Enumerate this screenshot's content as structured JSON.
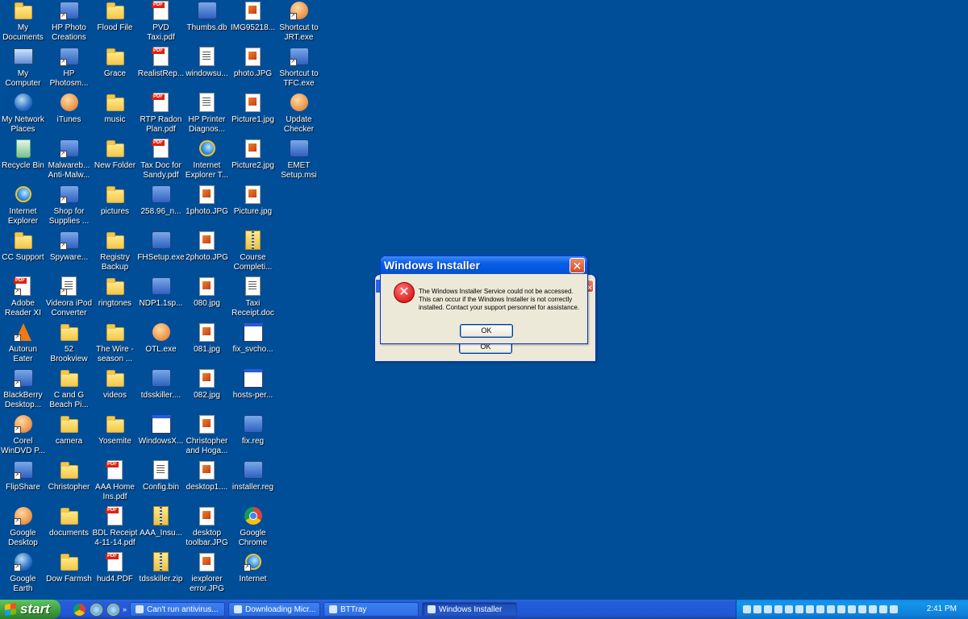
{
  "desktop": {
    "icons": [
      {
        "label": "My\nDocuments",
        "icon": "my-documents-icon",
        "type": "folder",
        "shortcut": false
      },
      {
        "label": "My\nComputer",
        "icon": "my-computer-icon",
        "type": "pc",
        "shortcut": false
      },
      {
        "label": "My Network\nPlaces",
        "icon": "network-places-icon",
        "type": "globe",
        "shortcut": false
      },
      {
        "label": "Recycle Bin",
        "icon": "recycle-bin-icon",
        "type": "bin",
        "shortcut": false
      },
      {
        "label": "Internet\nExplorer",
        "icon": "internet-explorer-icon",
        "type": "ie",
        "shortcut": false
      },
      {
        "label": "CC Support",
        "icon": "folder-icon",
        "type": "folder",
        "shortcut": false
      },
      {
        "label": "Adobe\nReader XI",
        "icon": "adobe-reader-icon",
        "type": "pdf",
        "shortcut": true
      },
      {
        "label": "Autorun\nEater",
        "icon": "autorun-eater-icon",
        "type": "cone",
        "shortcut": true
      },
      {
        "label": "BlackBerry\nDesktop...",
        "icon": "blackberry-icon",
        "type": "app",
        "shortcut": true
      },
      {
        "label": "Corel\nWinDVD P...",
        "icon": "corel-windvd-icon",
        "type": "round",
        "shortcut": true
      },
      {
        "label": "FlipShare",
        "icon": "flipshare-icon",
        "type": "app",
        "shortcut": true
      },
      {
        "label": "Google\nDesktop",
        "icon": "google-desktop-icon",
        "type": "round",
        "shortcut": true
      },
      {
        "label": "Google\nEarth",
        "icon": "google-earth-icon",
        "type": "globe",
        "shortcut": true
      },
      {
        "label": "HP Photo\nCreations",
        "icon": "hp-photo-icon",
        "type": "app",
        "shortcut": true
      },
      {
        "label": "HP\nPhotosm...",
        "icon": "hp-photosmart-icon",
        "type": "app",
        "shortcut": true
      },
      {
        "label": "iTunes",
        "icon": "itunes-icon",
        "type": "round",
        "shortcut": false
      },
      {
        "label": "Malwareb...\nAnti-Malw...",
        "icon": "malwarebytes-icon",
        "type": "app",
        "shortcut": true
      },
      {
        "label": "Shop for\nSupplies ...",
        "icon": "shop-supplies-icon",
        "type": "app",
        "shortcut": true
      },
      {
        "label": "Spyware...",
        "icon": "spyware-icon",
        "type": "app",
        "shortcut": true
      },
      {
        "label": "Videora iPod\nConverter",
        "icon": "videora-icon",
        "type": "doc",
        "shortcut": true
      },
      {
        "label": "52\nBrookview",
        "icon": "folder-icon",
        "type": "folder",
        "shortcut": false
      },
      {
        "label": "C and G\nBeach Pi...",
        "icon": "folder-icon",
        "type": "folder",
        "shortcut": false
      },
      {
        "label": "camera",
        "icon": "folder-icon",
        "type": "folder",
        "shortcut": false
      },
      {
        "label": "Christopher",
        "icon": "folder-icon",
        "type": "folder",
        "shortcut": false
      },
      {
        "label": "documents",
        "icon": "folder-icon",
        "type": "folder",
        "shortcut": false
      },
      {
        "label": "Dow Farmsh",
        "icon": "folder-icon",
        "type": "folder",
        "shortcut": false
      },
      {
        "label": "Flood File",
        "icon": "folder-icon",
        "type": "folder",
        "shortcut": false
      },
      {
        "label": "Grace",
        "icon": "folder-icon",
        "type": "folder",
        "shortcut": false
      },
      {
        "label": "music",
        "icon": "folder-icon",
        "type": "folder",
        "shortcut": false
      },
      {
        "label": "New Folder",
        "icon": "folder-icon",
        "type": "folder",
        "shortcut": false
      },
      {
        "label": "pictures",
        "icon": "folder-icon",
        "type": "folder",
        "shortcut": false
      },
      {
        "label": "Registry\nBackup",
        "icon": "folder-icon",
        "type": "folder",
        "shortcut": false
      },
      {
        "label": "ringtones",
        "icon": "folder-icon",
        "type": "folder",
        "shortcut": false
      },
      {
        "label": "The Wire -\nseason ...",
        "icon": "folder-icon",
        "type": "folder",
        "shortcut": false
      },
      {
        "label": "videos",
        "icon": "folder-icon",
        "type": "folder",
        "shortcut": false
      },
      {
        "label": "Yosemite",
        "icon": "folder-icon",
        "type": "folder",
        "shortcut": false
      },
      {
        "label": "AAA Home\nIns.pdf",
        "icon": "pdf-icon",
        "type": "pdf",
        "shortcut": false
      },
      {
        "label": "BDL Receipt\n4-11-14.pdf",
        "icon": "pdf-icon",
        "type": "pdf",
        "shortcut": false
      },
      {
        "label": "hud4.PDF",
        "icon": "pdf-icon",
        "type": "pdf",
        "shortcut": false
      },
      {
        "label": "PVD\nTaxi.pdf",
        "icon": "pdf-icon",
        "type": "pdf",
        "shortcut": false
      },
      {
        "label": "RealistRep...",
        "icon": "pdf-icon",
        "type": "pdf",
        "shortcut": false
      },
      {
        "label": "RTP Radon\nPlan.pdf",
        "icon": "pdf-icon",
        "type": "pdf",
        "shortcut": false
      },
      {
        "label": "Tax Doc for\nSandy.pdf",
        "icon": "pdf-icon",
        "type": "pdf",
        "shortcut": false
      },
      {
        "label": "258.96_n...",
        "icon": "nvidia-icon",
        "type": "app",
        "shortcut": false
      },
      {
        "label": "FHSetup.exe",
        "icon": "setup-icon",
        "type": "app",
        "shortcut": false
      },
      {
        "label": "NDP1.1sp...",
        "icon": "setup-icon",
        "type": "app",
        "shortcut": false
      },
      {
        "label": "OTL.exe",
        "icon": "otl-icon",
        "type": "round",
        "shortcut": false
      },
      {
        "label": "tdsskiller....",
        "icon": "tdsskiller-icon",
        "type": "app",
        "shortcut": false
      },
      {
        "label": "WindowsX...",
        "icon": "window-icon",
        "type": "win",
        "shortcut": false
      },
      {
        "label": "Config.bin",
        "icon": "file-icon",
        "type": "doc",
        "shortcut": false
      },
      {
        "label": "AAA_Insu...",
        "icon": "zip-icon",
        "type": "zip",
        "shortcut": false
      },
      {
        "label": "tdsskiller.zip",
        "icon": "zip-icon",
        "type": "zip",
        "shortcut": false
      },
      {
        "label": "Thumbs.db",
        "icon": "thumbs-db-icon",
        "type": "app",
        "shortcut": false
      },
      {
        "label": "windowsu...",
        "icon": "file-icon",
        "type": "doc",
        "shortcut": false
      },
      {
        "label": "HP Printer\nDiagnos...",
        "icon": "file-icon",
        "type": "doc",
        "shortcut": false
      },
      {
        "label": "Internet\nExplorer T...",
        "icon": "internet-explorer-icon",
        "type": "ie",
        "shortcut": false
      },
      {
        "label": "1photo.JPG",
        "icon": "image-icon",
        "type": "img",
        "shortcut": false
      },
      {
        "label": "2photo.JPG",
        "icon": "image-icon",
        "type": "img",
        "shortcut": false
      },
      {
        "label": "080.jpg",
        "icon": "image-icon",
        "type": "img",
        "shortcut": false
      },
      {
        "label": "081.jpg",
        "icon": "image-icon",
        "type": "img",
        "shortcut": false
      },
      {
        "label": "082.jpg",
        "icon": "image-icon",
        "type": "img",
        "shortcut": false
      },
      {
        "label": "Christopher\nand Hoga...",
        "icon": "image-icon",
        "type": "img",
        "shortcut": false
      },
      {
        "label": "desktop1....",
        "icon": "image-icon",
        "type": "img",
        "shortcut": false
      },
      {
        "label": "desktop\ntoolbar.JPG",
        "icon": "image-icon",
        "type": "img",
        "shortcut": false
      },
      {
        "label": "iexplorer\nerror.JPG",
        "icon": "image-icon",
        "type": "img",
        "shortcut": false
      },
      {
        "label": "IMG95218...",
        "icon": "image-icon",
        "type": "img",
        "shortcut": false
      },
      {
        "label": "photo.JPG",
        "icon": "image-icon",
        "type": "img",
        "shortcut": false
      },
      {
        "label": "Picture1.jpg",
        "icon": "image-icon",
        "type": "img",
        "shortcut": false
      },
      {
        "label": "Picture2.jpg",
        "icon": "image-icon",
        "type": "img",
        "shortcut": false
      },
      {
        "label": "Picture.jpg",
        "icon": "image-icon",
        "type": "img",
        "shortcut": false
      },
      {
        "label": "Course\nCompleti...",
        "icon": "file-icon",
        "type": "zip",
        "shortcut": false
      },
      {
        "label": "Taxi\nReceipt.doc",
        "icon": "word-doc-icon",
        "type": "doc",
        "shortcut": false
      },
      {
        "label": "fix_svcho...",
        "icon": "script-icon",
        "type": "win",
        "shortcut": false
      },
      {
        "label": "hosts-per...",
        "icon": "script-icon",
        "type": "win",
        "shortcut": false
      },
      {
        "label": "fix.reg",
        "icon": "reg-icon",
        "type": "app",
        "shortcut": false
      },
      {
        "label": "installer.reg",
        "icon": "reg-icon",
        "type": "app",
        "shortcut": false
      },
      {
        "label": "Google\nChrome",
        "icon": "chrome-icon",
        "type": "chrome",
        "shortcut": false
      },
      {
        "label": "Internet",
        "icon": "internet-explorer-icon",
        "type": "ie",
        "shortcut": true
      },
      {
        "label": "Shortcut to\nJRT.exe",
        "icon": "jrt-icon",
        "type": "round",
        "shortcut": true
      },
      {
        "label": "Shortcut to\nTFC.exe",
        "icon": "tfc-icon",
        "type": "app",
        "shortcut": true
      },
      {
        "label": "Update\nChecker",
        "icon": "update-checker-icon",
        "type": "round",
        "shortcut": false
      },
      {
        "label": "EMET\nSetup.msi",
        "icon": "installer-icon",
        "type": "app",
        "shortcut": false
      }
    ]
  },
  "dialog": {
    "title": "Windows Installer",
    "message": "The Windows Installer Service could not be accessed. This can occur if the Windows Installer is not correctly installed. Contact your support personnel for assistance.",
    "ok_label": "OK",
    "back_ok_label": "OK"
  },
  "taskbar": {
    "start_label": "start",
    "tasks": [
      {
        "label": "Can't run antivirus...",
        "active": false
      },
      {
        "label": "Downloading Micr...",
        "active": false
      },
      {
        "label": "BTTray",
        "active": false
      },
      {
        "label": "Windows Installer",
        "active": true
      }
    ],
    "clock": "2:41 PM"
  },
  "colors": {
    "desktop": "#004e98",
    "xp_blue": "#0a5ce6",
    "start_green": "#3c9b3c"
  }
}
